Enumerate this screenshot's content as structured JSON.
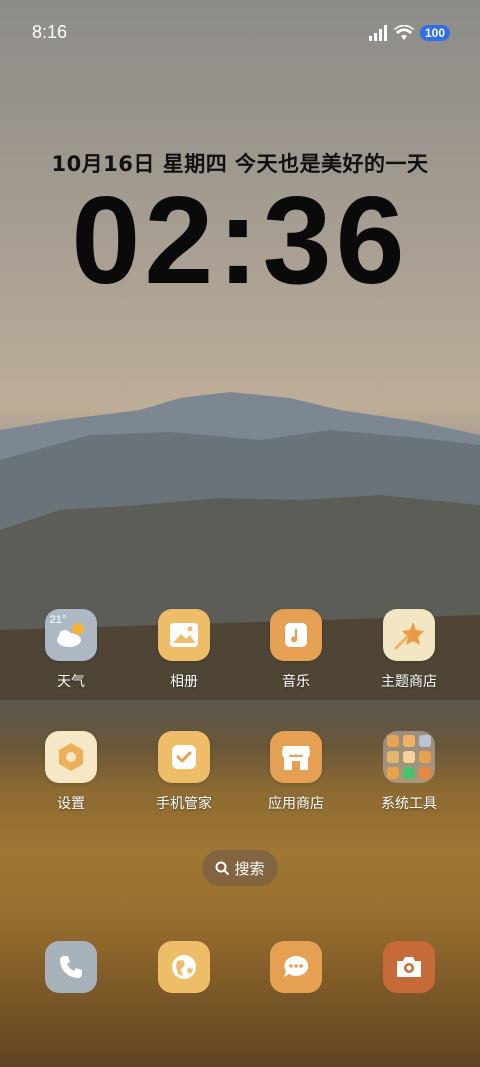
{
  "status_bar": {
    "time": "8:16",
    "battery": "100",
    "signal_icon": "cellular-signal-icon",
    "wifi_icon": "wifi-icon"
  },
  "lock": {
    "date_line": "10月16日  星期四  今天也是美好的一天",
    "clock": "02:36"
  },
  "apps": [
    {
      "label": "天气",
      "icon": "weather-icon",
      "temp": "21°"
    },
    {
      "label": "相册",
      "icon": "gallery-icon"
    },
    {
      "label": "音乐",
      "icon": "music-icon"
    },
    {
      "label": "主题商店",
      "icon": "theme-store-icon"
    },
    {
      "label": "设置",
      "icon": "settings-icon"
    },
    {
      "label": "手机管家",
      "icon": "phone-manager-icon"
    },
    {
      "label": "应用商店",
      "icon": "app-store-icon"
    },
    {
      "label": "系统工具",
      "icon": "system-tools-folder-icon"
    }
  ],
  "search": {
    "label": "搜索"
  },
  "dock": [
    {
      "icon": "phone-icon"
    },
    {
      "icon": "browser-icon"
    },
    {
      "icon": "messages-icon"
    },
    {
      "icon": "camera-icon"
    }
  ],
  "colors": {
    "app_orange": "#e6a053",
    "app_yellow": "#eebd6a",
    "weather_bg": "#aeb8c4",
    "theme_bg": "#f3e6c2",
    "settings_bg": "#f6e7c5",
    "phone_bg": "#a8b2bb",
    "camera_bg": "#c76a3a",
    "battery_blue": "#2f6fe8"
  }
}
